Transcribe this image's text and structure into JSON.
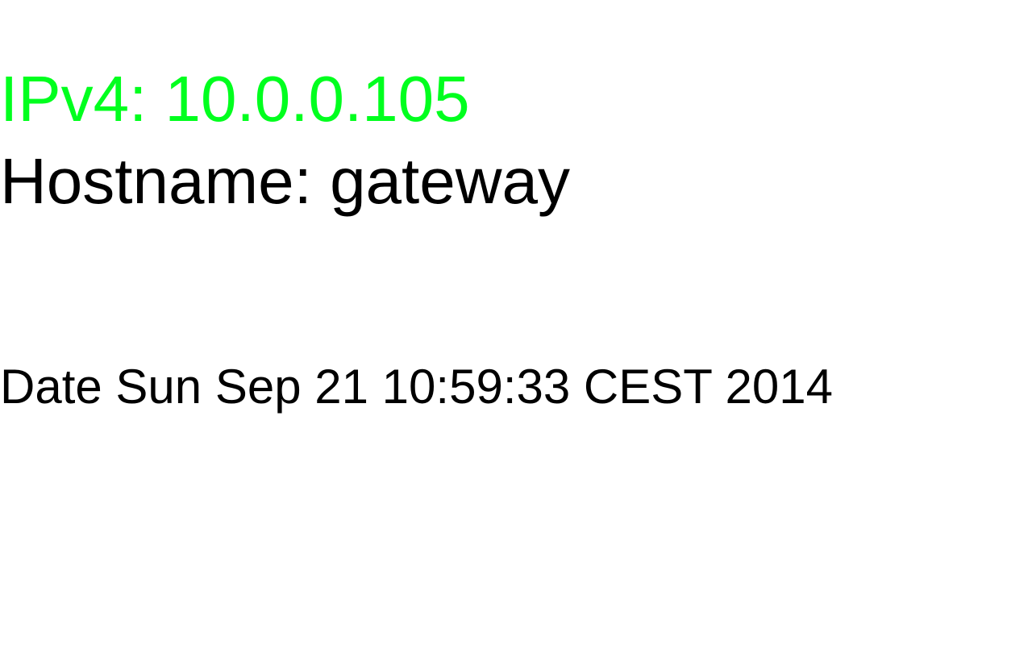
{
  "network": {
    "ipv4_label": "IPv4: 10.0.0.105",
    "hostname_label": "Hostname: gateway"
  },
  "clock": {
    "date_label": "Date Sun Sep 21 10:59:33 CEST 2014"
  },
  "colors": {
    "ipv4_text": "#00ff1e",
    "default_text": "#000000",
    "background": "#ffffff"
  }
}
